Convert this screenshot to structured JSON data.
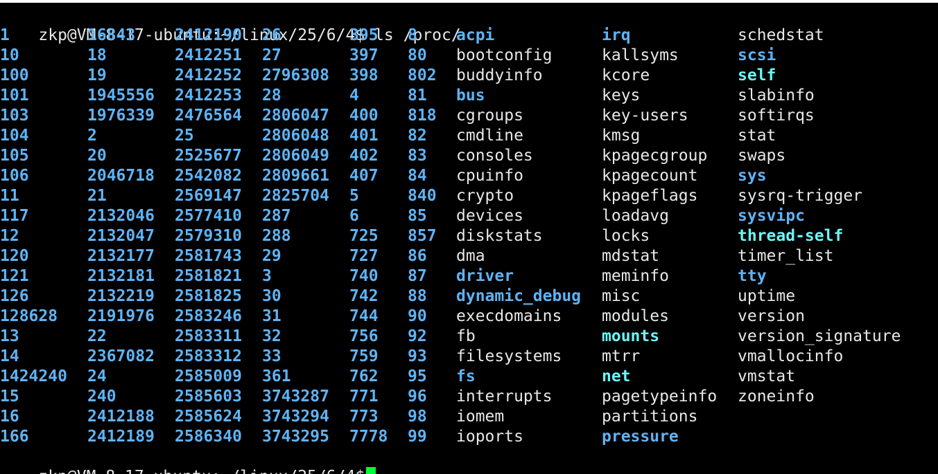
{
  "colors": {
    "background": "#000000",
    "text": "#e8e8e8",
    "directory": "#5fb3f5",
    "symlink": "#6ef5f5",
    "cursor": "#00ff33"
  },
  "prompt": {
    "text": "zkp@VM-8-17-ubuntu:~/linux/25/6/4$",
    "command": " ls /proc/"
  },
  "listing": {
    "columns": [
      {
        "items": [
          {
            "name": "1",
            "type": "dir"
          },
          {
            "name": "10",
            "type": "dir"
          },
          {
            "name": "100",
            "type": "dir"
          },
          {
            "name": "101",
            "type": "dir"
          },
          {
            "name": "103",
            "type": "dir"
          },
          {
            "name": "104",
            "type": "dir"
          },
          {
            "name": "105",
            "type": "dir"
          },
          {
            "name": "106",
            "type": "dir"
          },
          {
            "name": "11",
            "type": "dir"
          },
          {
            "name": "117",
            "type": "dir"
          },
          {
            "name": "12",
            "type": "dir"
          },
          {
            "name": "120",
            "type": "dir"
          },
          {
            "name": "121",
            "type": "dir"
          },
          {
            "name": "126",
            "type": "dir"
          },
          {
            "name": "128628",
            "type": "dir"
          },
          {
            "name": "13",
            "type": "dir"
          },
          {
            "name": "14",
            "type": "dir"
          },
          {
            "name": "1424240",
            "type": "dir"
          },
          {
            "name": "15",
            "type": "dir"
          },
          {
            "name": "16",
            "type": "dir"
          },
          {
            "name": "166",
            "type": "dir"
          }
        ]
      },
      {
        "items": [
          {
            "name": "16843",
            "type": "dir"
          },
          {
            "name": "18",
            "type": "dir"
          },
          {
            "name": "19",
            "type": "dir"
          },
          {
            "name": "1945556",
            "type": "dir"
          },
          {
            "name": "1976339",
            "type": "dir"
          },
          {
            "name": "2",
            "type": "dir"
          },
          {
            "name": "20",
            "type": "dir"
          },
          {
            "name": "2046718",
            "type": "dir"
          },
          {
            "name": "21",
            "type": "dir"
          },
          {
            "name": "2132046",
            "type": "dir"
          },
          {
            "name": "2132047",
            "type": "dir"
          },
          {
            "name": "2132177",
            "type": "dir"
          },
          {
            "name": "2132181",
            "type": "dir"
          },
          {
            "name": "2132219",
            "type": "dir"
          },
          {
            "name": "2191976",
            "type": "dir"
          },
          {
            "name": "22",
            "type": "dir"
          },
          {
            "name": "2367082",
            "type": "dir"
          },
          {
            "name": "24",
            "type": "dir"
          },
          {
            "name": "240",
            "type": "dir"
          },
          {
            "name": "2412188",
            "type": "dir"
          },
          {
            "name": "2412189",
            "type": "dir"
          }
        ]
      },
      {
        "items": [
          {
            "name": "2412190",
            "type": "dir"
          },
          {
            "name": "2412251",
            "type": "dir"
          },
          {
            "name": "2412252",
            "type": "dir"
          },
          {
            "name": "2412253",
            "type": "dir"
          },
          {
            "name": "2476564",
            "type": "dir"
          },
          {
            "name": "25",
            "type": "dir"
          },
          {
            "name": "2525677",
            "type": "dir"
          },
          {
            "name": "2542082",
            "type": "dir"
          },
          {
            "name": "2569147",
            "type": "dir"
          },
          {
            "name": "2577410",
            "type": "dir"
          },
          {
            "name": "2579310",
            "type": "dir"
          },
          {
            "name": "2581743",
            "type": "dir"
          },
          {
            "name": "2581821",
            "type": "dir"
          },
          {
            "name": "2581825",
            "type": "dir"
          },
          {
            "name": "2583246",
            "type": "dir"
          },
          {
            "name": "2583311",
            "type": "dir"
          },
          {
            "name": "2583312",
            "type": "dir"
          },
          {
            "name": "2585009",
            "type": "dir"
          },
          {
            "name": "2585603",
            "type": "dir"
          },
          {
            "name": "2585624",
            "type": "dir"
          },
          {
            "name": "2586340",
            "type": "dir"
          }
        ]
      },
      {
        "items": [
          {
            "name": "26",
            "type": "dir"
          },
          {
            "name": "27",
            "type": "dir"
          },
          {
            "name": "2796308",
            "type": "dir"
          },
          {
            "name": "28",
            "type": "dir"
          },
          {
            "name": "2806047",
            "type": "dir"
          },
          {
            "name": "2806048",
            "type": "dir"
          },
          {
            "name": "2806049",
            "type": "dir"
          },
          {
            "name": "2809661",
            "type": "dir"
          },
          {
            "name": "2825704",
            "type": "dir"
          },
          {
            "name": "287",
            "type": "dir"
          },
          {
            "name": "288",
            "type": "dir"
          },
          {
            "name": "29",
            "type": "dir"
          },
          {
            "name": "3",
            "type": "dir"
          },
          {
            "name": "30",
            "type": "dir"
          },
          {
            "name": "31",
            "type": "dir"
          },
          {
            "name": "32",
            "type": "dir"
          },
          {
            "name": "33",
            "type": "dir"
          },
          {
            "name": "361",
            "type": "dir"
          },
          {
            "name": "3743287",
            "type": "dir"
          },
          {
            "name": "3743294",
            "type": "dir"
          },
          {
            "name": "3743295",
            "type": "dir"
          }
        ]
      },
      {
        "items": [
          {
            "name": "395",
            "type": "dir"
          },
          {
            "name": "397",
            "type": "dir"
          },
          {
            "name": "398",
            "type": "dir"
          },
          {
            "name": "4",
            "type": "dir"
          },
          {
            "name": "400",
            "type": "dir"
          },
          {
            "name": "401",
            "type": "dir"
          },
          {
            "name": "402",
            "type": "dir"
          },
          {
            "name": "407",
            "type": "dir"
          },
          {
            "name": "5",
            "type": "dir"
          },
          {
            "name": "6",
            "type": "dir"
          },
          {
            "name": "725",
            "type": "dir"
          },
          {
            "name": "727",
            "type": "dir"
          },
          {
            "name": "740",
            "type": "dir"
          },
          {
            "name": "742",
            "type": "dir"
          },
          {
            "name": "744",
            "type": "dir"
          },
          {
            "name": "756",
            "type": "dir"
          },
          {
            "name": "759",
            "type": "dir"
          },
          {
            "name": "762",
            "type": "dir"
          },
          {
            "name": "771",
            "type": "dir"
          },
          {
            "name": "773",
            "type": "dir"
          },
          {
            "name": "7778",
            "type": "dir"
          }
        ]
      },
      {
        "items": [
          {
            "name": "8",
            "type": "dir"
          },
          {
            "name": "80",
            "type": "dir"
          },
          {
            "name": "802",
            "type": "dir"
          },
          {
            "name": "81",
            "type": "dir"
          },
          {
            "name": "818",
            "type": "dir"
          },
          {
            "name": "82",
            "type": "dir"
          },
          {
            "name": "83",
            "type": "dir"
          },
          {
            "name": "84",
            "type": "dir"
          },
          {
            "name": "840",
            "type": "dir"
          },
          {
            "name": "85",
            "type": "dir"
          },
          {
            "name": "857",
            "type": "dir"
          },
          {
            "name": "86",
            "type": "dir"
          },
          {
            "name": "87",
            "type": "dir"
          },
          {
            "name": "88",
            "type": "dir"
          },
          {
            "name": "90",
            "type": "dir"
          },
          {
            "name": "92",
            "type": "dir"
          },
          {
            "name": "93",
            "type": "dir"
          },
          {
            "name": "95",
            "type": "dir"
          },
          {
            "name": "96",
            "type": "dir"
          },
          {
            "name": "98",
            "type": "dir"
          },
          {
            "name": "99",
            "type": "dir"
          }
        ]
      },
      {
        "items": [
          {
            "name": "acpi",
            "type": "dir"
          },
          {
            "name": "bootconfig",
            "type": "file"
          },
          {
            "name": "buddyinfo",
            "type": "file"
          },
          {
            "name": "bus",
            "type": "dir"
          },
          {
            "name": "cgroups",
            "type": "file"
          },
          {
            "name": "cmdline",
            "type": "file"
          },
          {
            "name": "consoles",
            "type": "file"
          },
          {
            "name": "cpuinfo",
            "type": "file"
          },
          {
            "name": "crypto",
            "type": "file"
          },
          {
            "name": "devices",
            "type": "file"
          },
          {
            "name": "diskstats",
            "type": "file"
          },
          {
            "name": "dma",
            "type": "file"
          },
          {
            "name": "driver",
            "type": "dir"
          },
          {
            "name": "dynamic_debug",
            "type": "dir"
          },
          {
            "name": "execdomains",
            "type": "file"
          },
          {
            "name": "fb",
            "type": "file"
          },
          {
            "name": "filesystems",
            "type": "file"
          },
          {
            "name": "fs",
            "type": "dir"
          },
          {
            "name": "interrupts",
            "type": "file"
          },
          {
            "name": "iomem",
            "type": "file"
          },
          {
            "name": "ioports",
            "type": "file"
          }
        ]
      },
      {
        "items": [
          {
            "name": "irq",
            "type": "dir"
          },
          {
            "name": "kallsyms",
            "type": "file"
          },
          {
            "name": "kcore",
            "type": "file"
          },
          {
            "name": "keys",
            "type": "file"
          },
          {
            "name": "key-users",
            "type": "file"
          },
          {
            "name": "kmsg",
            "type": "file"
          },
          {
            "name": "kpagecgroup",
            "type": "file"
          },
          {
            "name": "kpagecount",
            "type": "file"
          },
          {
            "name": "kpageflags",
            "type": "file"
          },
          {
            "name": "loadavg",
            "type": "file"
          },
          {
            "name": "locks",
            "type": "file"
          },
          {
            "name": "mdstat",
            "type": "file"
          },
          {
            "name": "meminfo",
            "type": "file"
          },
          {
            "name": "misc",
            "type": "file"
          },
          {
            "name": "modules",
            "type": "file"
          },
          {
            "name": "mounts",
            "type": "link"
          },
          {
            "name": "mtrr",
            "type": "file"
          },
          {
            "name": "net",
            "type": "link"
          },
          {
            "name": "pagetypeinfo",
            "type": "file"
          },
          {
            "name": "partitions",
            "type": "file"
          },
          {
            "name": "pressure",
            "type": "dir"
          }
        ]
      },
      {
        "items": [
          {
            "name": "schedstat",
            "type": "file"
          },
          {
            "name": "scsi",
            "type": "dir"
          },
          {
            "name": "self",
            "type": "link"
          },
          {
            "name": "slabinfo",
            "type": "file"
          },
          {
            "name": "softirqs",
            "type": "file"
          },
          {
            "name": "stat",
            "type": "file"
          },
          {
            "name": "swaps",
            "type": "file"
          },
          {
            "name": "sys",
            "type": "dir"
          },
          {
            "name": "sysrq-trigger",
            "type": "file"
          },
          {
            "name": "sysvipc",
            "type": "dir"
          },
          {
            "name": "thread-self",
            "type": "link"
          },
          {
            "name": "timer_list",
            "type": "file"
          },
          {
            "name": "tty",
            "type": "dir"
          },
          {
            "name": "uptime",
            "type": "file"
          },
          {
            "name": "version",
            "type": "file"
          },
          {
            "name": "version_signature",
            "type": "file"
          },
          {
            "name": "vmallocinfo",
            "type": "file"
          },
          {
            "name": "vmstat",
            "type": "file"
          },
          {
            "name": "zoneinfo",
            "type": "file"
          }
        ]
      }
    ]
  }
}
